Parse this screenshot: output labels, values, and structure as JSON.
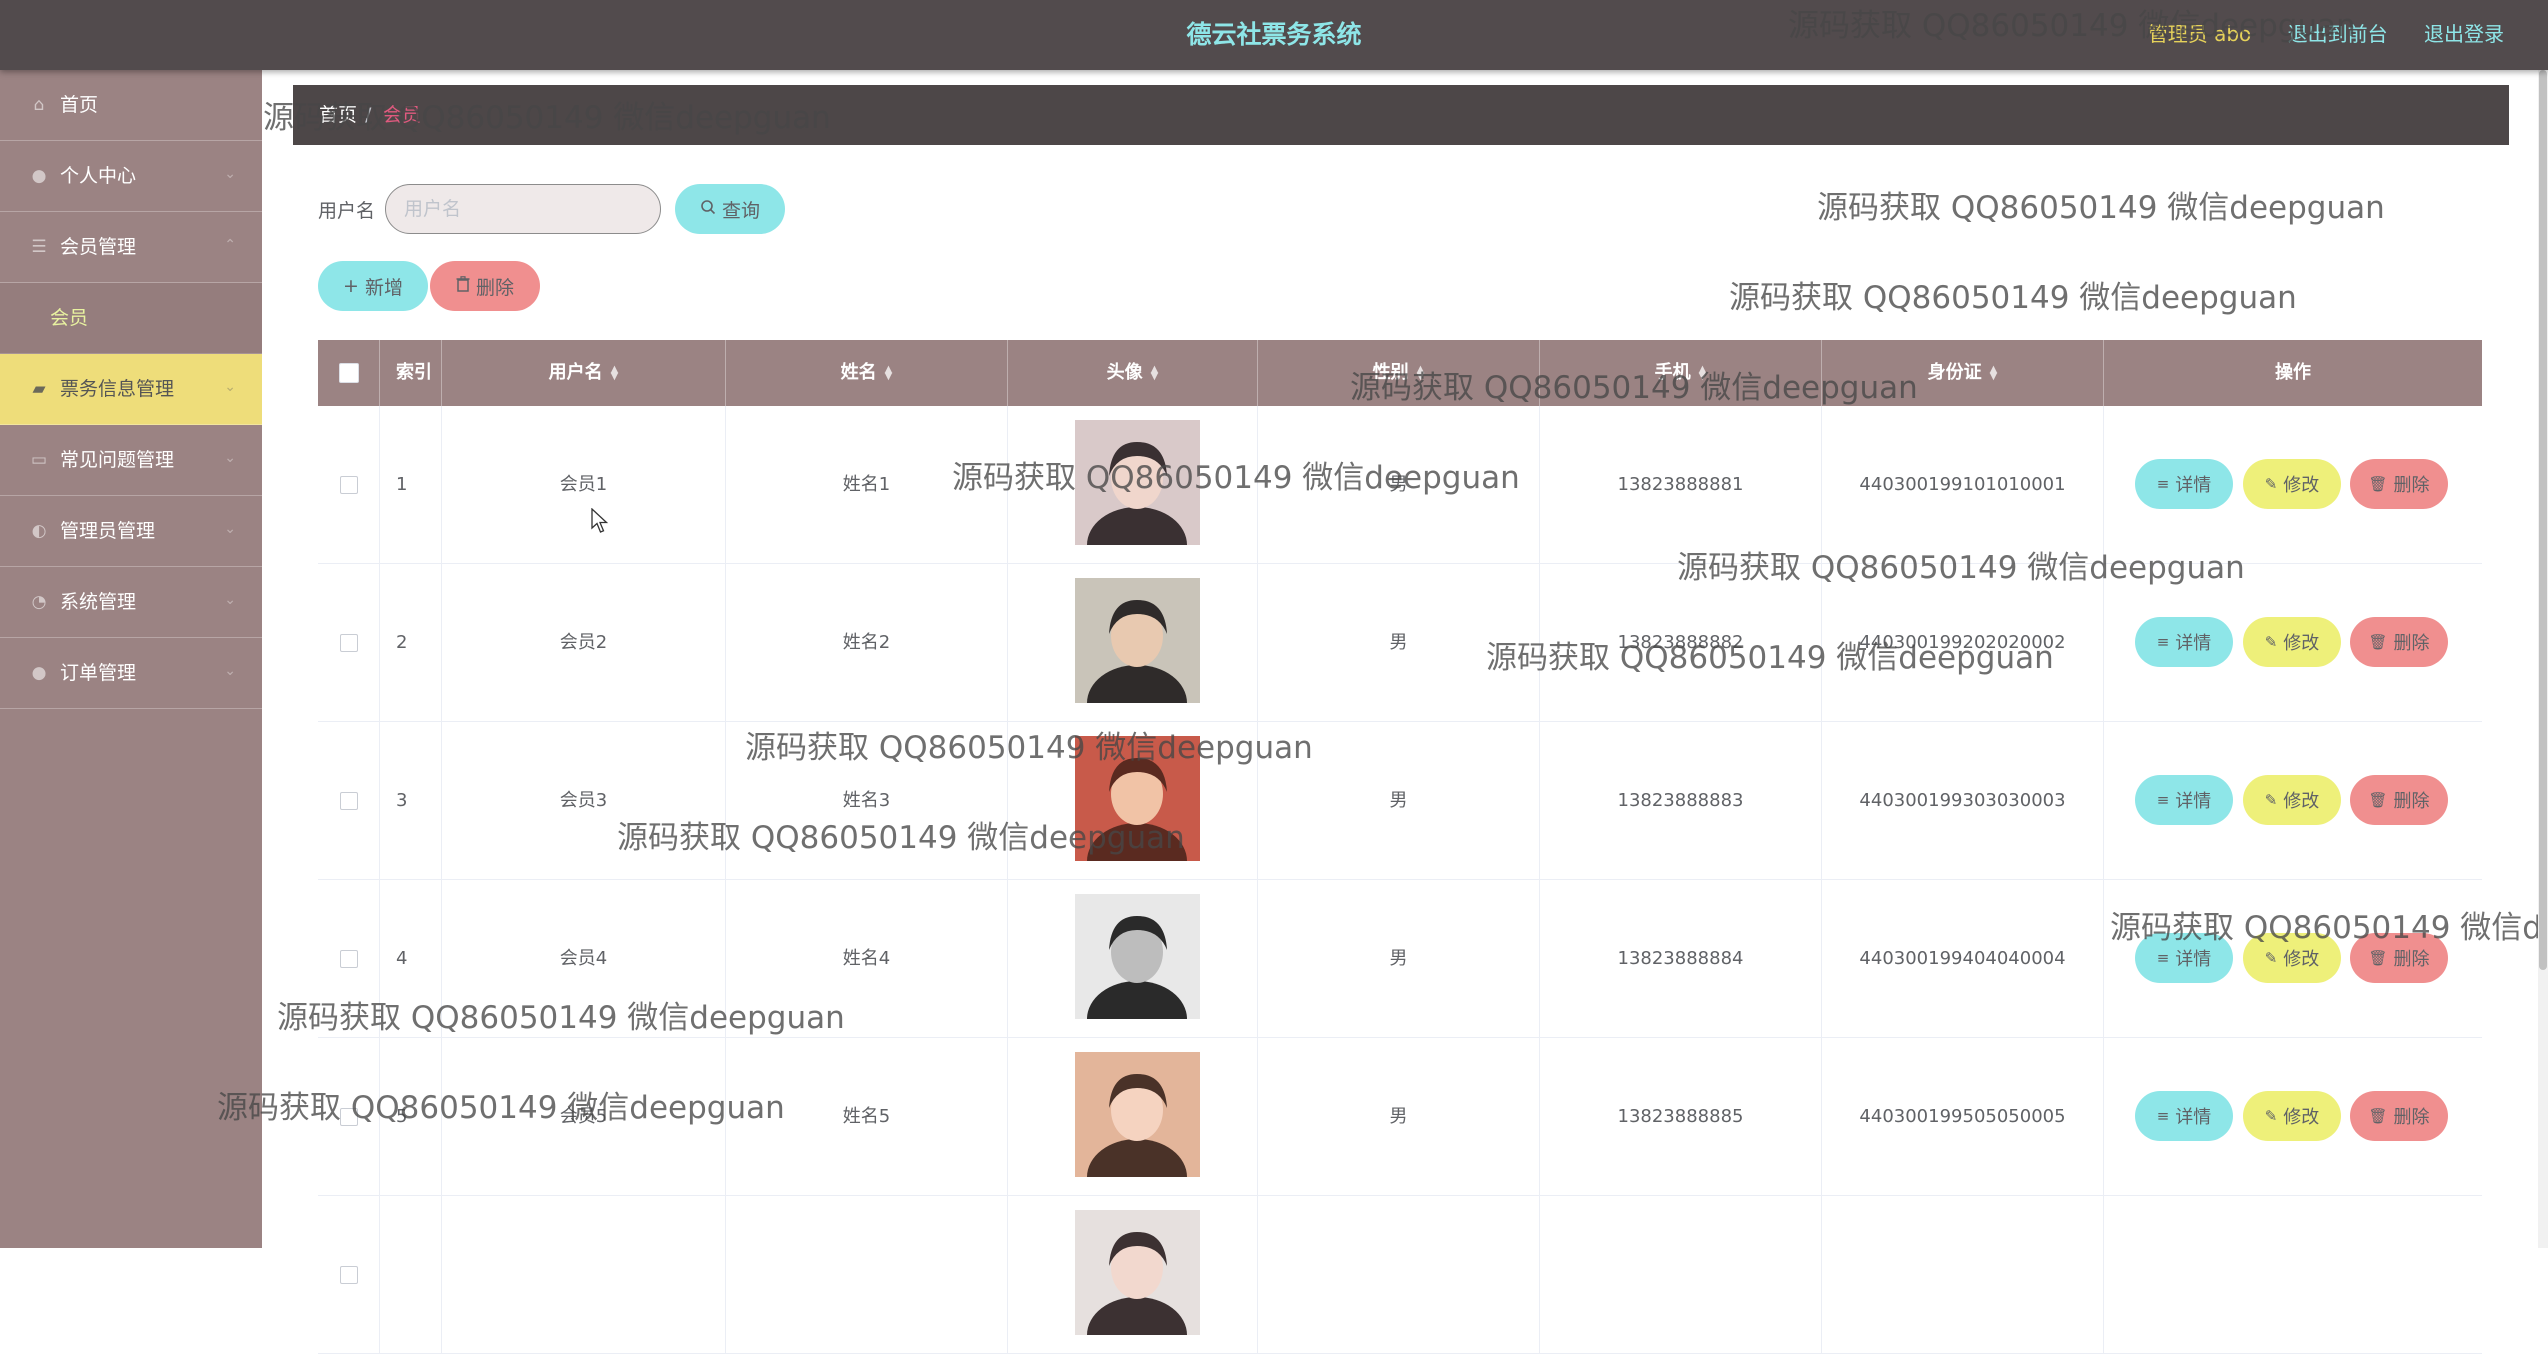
{
  "header": {
    "title": "德云社票务系统",
    "admin_label": "管理员 abo",
    "front_link": "退出到前台",
    "logout_link": "退出登录"
  },
  "sidebar": {
    "items": [
      {
        "label": "首页",
        "icon": "home-icon"
      },
      {
        "label": "个人中心",
        "icon": "user-icon"
      },
      {
        "label": "会员管理",
        "icon": "list-icon",
        "sub": [
          "会员"
        ]
      },
      {
        "label": "票务信息管理",
        "icon": "ticket-icon",
        "active": true
      },
      {
        "label": "常见问题管理",
        "icon": "question-icon"
      },
      {
        "label": "管理员管理",
        "icon": "admin-icon"
      },
      {
        "label": "系统管理",
        "icon": "settings-icon"
      },
      {
        "label": "订单管理",
        "icon": "order-icon"
      }
    ],
    "bg_color": "#9b8383",
    "active_color": "#eedd7a"
  },
  "breadcrumb": {
    "home": "首页",
    "separator": "/",
    "current": "会员"
  },
  "search": {
    "label": "用户名",
    "placeholder": "用户名",
    "value": "",
    "query_button": "查询"
  },
  "actions": {
    "add_button": "新增",
    "delete_button": "删除"
  },
  "table": {
    "columns": [
      "索引",
      "用户名",
      "姓名",
      "头像",
      "性别",
      "手机",
      "身份证",
      "操作"
    ],
    "rows": [
      {
        "index": "1",
        "username": "会员1",
        "name": "姓名1",
        "gender": "男",
        "phone": "13823888881",
        "idcard": "440300199101010001"
      },
      {
        "index": "2",
        "username": "会员2",
        "name": "姓名2",
        "gender": "男",
        "phone": "13823888882",
        "idcard": "440300199202020002"
      },
      {
        "index": "3",
        "username": "会员3",
        "name": "姓名3",
        "gender": "男",
        "phone": "13823888883",
        "idcard": "440300199303030003"
      },
      {
        "index": "4",
        "username": "会员4",
        "name": "姓名4",
        "gender": "男",
        "phone": "13823888884",
        "idcard": "440300199404040004"
      },
      {
        "index": "5",
        "username": "会员5",
        "name": "姓名5",
        "gender": "男",
        "phone": "13823888885",
        "idcard": "440300199505050005"
      },
      {
        "index": "",
        "username": "",
        "name": "",
        "gender": "",
        "phone": "",
        "idcard": ""
      }
    ],
    "row_actions": {
      "detail": "详情",
      "edit": "修改",
      "delete": "删除"
    },
    "header_color": "#9b8383"
  },
  "watermark_text": "源码获取 QQ86050149 微信deepguan",
  "colors": {
    "accent_cyan": "#8ee6e8",
    "accent_yellow": "#eef07a",
    "accent_red": "#f08f8f",
    "topbar": "#524b4d"
  }
}
